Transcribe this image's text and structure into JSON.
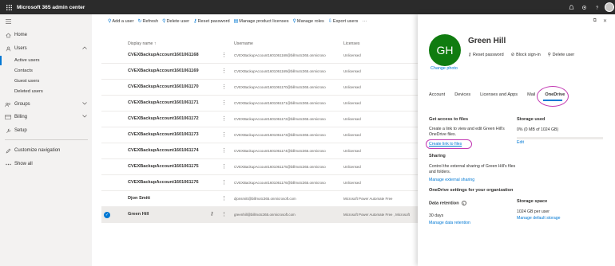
{
  "app": {
    "title": "Microsoft 365 admin center"
  },
  "nav": {
    "home": "Home",
    "users": "Users",
    "active_users": "Active users",
    "contacts": "Contacts",
    "guest_users": "Guest users",
    "deleted_users": "Deleted users",
    "groups": "Groups",
    "billing": "Billing",
    "setup": "Setup",
    "customize": "Customize navigation",
    "show_all": "Show all"
  },
  "toolbar": {
    "add_user": "Add a user",
    "refresh": "Refresh",
    "delete_user": "Delete user",
    "reset_password": "Reset password",
    "manage_licenses": "Manage product licenses",
    "manage_roles": "Manage roles",
    "export_users": "Export users"
  },
  "table": {
    "headers": {
      "display_name": "Display name ↑",
      "username": "Username",
      "licenses": "Licenses"
    },
    "rows": [
      {
        "name": "CVEXBackupAccount1601061168",
        "username": "CVEXBackupAccount1601061168@billmotc365.onmicroso",
        "license": "Unlicensed"
      },
      {
        "name": "CVEXBackupAccount1601061169",
        "username": "CVEXBackupAccount1601061169@billmotc365.onmicroso",
        "license": "Unlicensed"
      },
      {
        "name": "CVEXBackupAccount1601061170",
        "username": "CVEXBackupAccount1601061170@billmotc365.onmicroso",
        "license": "Unlicensed"
      },
      {
        "name": "CVEXBackupAccount1601061171",
        "username": "CVEXBackupAccount1601061171@billmotc365.onmicroso",
        "license": "Unlicensed"
      },
      {
        "name": "CVEXBackupAccount1601061172",
        "username": "CVEXBackupAccount1601061172@billmotc365.onmicroso",
        "license": "Unlicensed"
      },
      {
        "name": "CVEXBackupAccount1601061173",
        "username": "CVEXBackupAccount1601061173@billmotc365.onmicroso",
        "license": "Unlicensed"
      },
      {
        "name": "CVEXBackupAccount1601061174",
        "username": "CVEXBackupAccount1601061174@billmotc365.onmicroso",
        "license": "Unlicensed"
      },
      {
        "name": "CVEXBackupAccount1601061175",
        "username": "CVEXBackupAccount1601061175@billmotc365.onmicroso",
        "license": "Unlicensed"
      },
      {
        "name": "CVEXBackupAccount1601061176",
        "username": "CVEXBackupAccount1601061176@billmotc365.onmicroso",
        "license": "Unlicensed"
      },
      {
        "name": "Djon Smitt",
        "username": "djonsmitt@billmotc365.onmicrosoft.com",
        "license": "Microsoft Power Automate Free"
      },
      {
        "name": "Green Hill",
        "username": "greenhill@billmotc365.onmicrosoft.com",
        "license": "Microsoft Power Automate Free , Microsoft"
      }
    ]
  },
  "panel": {
    "initials": "GH",
    "name": "Green Hill",
    "change_photo": "Change photo",
    "reset_password": "Reset password",
    "block_signin": "Block sign-in",
    "delete_user": "Delete user",
    "tabs": [
      "Account",
      "Devices",
      "Licenses and Apps",
      "Mail",
      "OneDrive"
    ],
    "get_access_title": "Get access to files",
    "get_access_text": "Create a link to view and edit Green Hill's OneDrive files.",
    "create_link": "Create link to files",
    "storage_used_title": "Storage used",
    "storage_used_text": "0% (0 MB of 1024 GB)",
    "storage_used_percent": 0,
    "edit": "Edit",
    "sharing_title": "Sharing",
    "sharing_text": "Control the external sharing of Green Hill's files and folders.",
    "manage_sharing": "Manage external sharing",
    "org_settings_title": "OneDrive settings for your organization",
    "retention_title": "Data retention",
    "retention_text": "30 days",
    "manage_retention": "Manage data retention",
    "storage_space_title": "Storage space",
    "storage_space_text": "1024 GB per user",
    "manage_storage": "Manage default storage"
  }
}
